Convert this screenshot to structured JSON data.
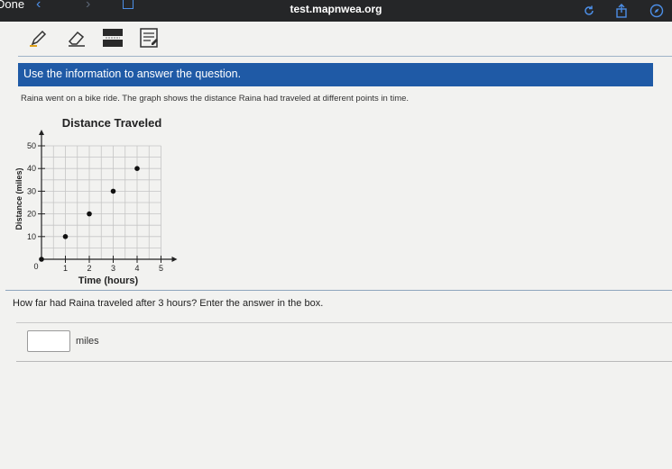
{
  "browser": {
    "done_label": "Done",
    "url": "test.mapnwea.org",
    "accent_color": "#4c8ee6"
  },
  "toolbar": {
    "tools": [
      "pencil-icon",
      "eraser-icon",
      "line-reader-icon",
      "notepad-icon"
    ]
  },
  "question": {
    "banner": "Use the information to answer the question.",
    "banner_color": "#1f5aa6",
    "prompt": "Raina went on a bike ride. The graph shows the distance Raina had traveled at different points in time.",
    "question_text": "How far had Raina traveled after 3 hours? Enter the answer in the box.",
    "answer_value": "",
    "answer_unit": "miles"
  },
  "chart_data": {
    "type": "scatter",
    "title": "Distance Traveled",
    "xlabel": "Time (hours)",
    "ylabel": "Distance (miles)",
    "x_ticks": [
      1,
      2,
      3,
      4,
      5
    ],
    "y_ticks": [
      10,
      20,
      30,
      40,
      50
    ],
    "origin_label": "0",
    "xlim": [
      0,
      5
    ],
    "ylim": [
      0,
      50
    ],
    "grid": true,
    "series": [
      {
        "points": [
          [
            1,
            10
          ],
          [
            2,
            20
          ],
          [
            3,
            30
          ],
          [
            4,
            40
          ]
        ]
      }
    ]
  }
}
